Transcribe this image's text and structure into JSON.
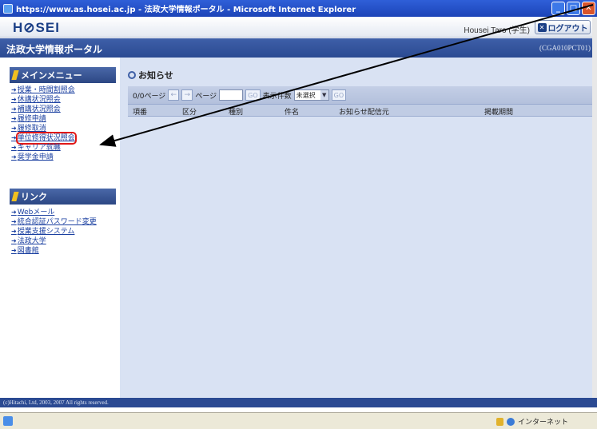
{
  "window": {
    "title": "https://www.as.hosei.ac.jp - 法政大学情報ポータル - Microsoft Internet Explorer",
    "btn_min": "_",
    "btn_max": "□",
    "btn_close": "✕"
  },
  "header": {
    "logo": "H⊘SEI",
    "user": "Housei Taro (学生)",
    "logout_label": "ログアウト",
    "logout_icon": "✕"
  },
  "portal": {
    "title": "法政大学情報ポータル",
    "code": "(CGA010PCT01)"
  },
  "sidebar": {
    "main_menu_label": "メインメニュー",
    "main_items": [
      {
        "label": "授業・時間割照会"
      },
      {
        "label": "休講状況照会"
      },
      {
        "label": "補講状況照会"
      },
      {
        "label": "履修申請"
      },
      {
        "label": "履修取消"
      },
      {
        "label": "単位修得状況照会",
        "highlighted": true
      },
      {
        "label": "キャリア就職"
      },
      {
        "label": "奨学金申請"
      }
    ],
    "link_label": "リンク",
    "link_items": [
      {
        "label": "Webメール"
      },
      {
        "label": "統合認証パスワード変更"
      },
      {
        "label": "授業支援システム"
      },
      {
        "label": "法政大学"
      },
      {
        "label": "図書館"
      }
    ]
  },
  "notices": {
    "title": "お知らせ",
    "pager": {
      "page_count": "0/0ページ",
      "prev": "←",
      "next": "→",
      "page_label": "ページ",
      "go": "GO",
      "display_count_label": "表示件数",
      "display_count_value": "未選択",
      "go2": "GO"
    },
    "columns": [
      "項番",
      "区分",
      "種別",
      "件名",
      "お知らせ配信元",
      "掲載期間"
    ]
  },
  "footer": "(c)Hitachi, Ltd, 2003, 2007 All rights reserved.",
  "statusbar": {
    "zone": "インターネット"
  },
  "colors": {
    "highlight": "#e01818",
    "arrow": "#000000"
  }
}
